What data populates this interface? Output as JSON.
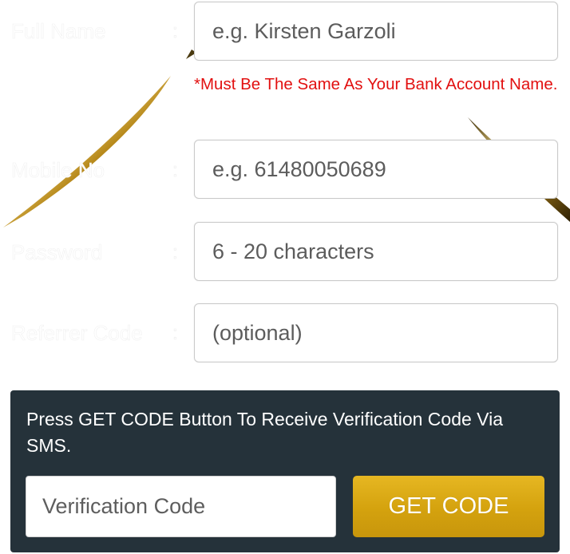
{
  "form": {
    "full_name": {
      "label": "Full Name",
      "colon": ":",
      "placeholder": "e.g. Kirsten Garzoli",
      "note": "*Must Be The Same As Your Bank Account Name."
    },
    "mobile": {
      "label": "Mobile No",
      "colon": ":",
      "placeholder": "e.g. 61480050689"
    },
    "password": {
      "label": "Password",
      "colon": ":",
      "placeholder": "6 - 20 characters"
    },
    "referrer": {
      "label": "Referrer Code",
      "colon": ":",
      "placeholder": "(optional)"
    }
  },
  "verification": {
    "message": "Press GET CODE Button To Receive Verification Code Via SMS.",
    "code_placeholder": "Verification Code",
    "button_label": "GET CODE"
  },
  "colors": {
    "note_red": "#e21010",
    "panel_bg": "#25323a",
    "button_gold": "#d4a20e"
  }
}
